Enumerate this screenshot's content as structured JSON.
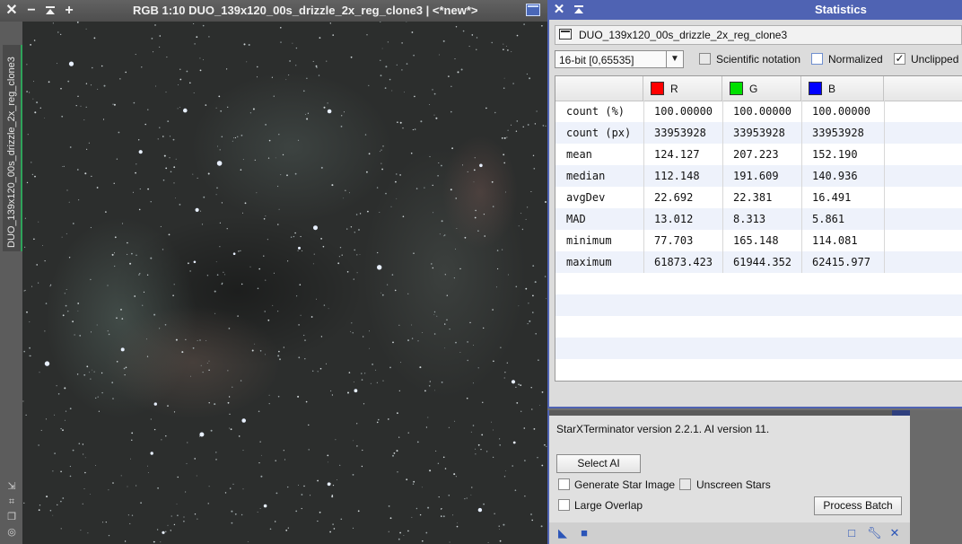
{
  "image_window": {
    "title": "RGB 1:10 DUO_139x120_00s_drizzle_2x_reg_clone3 | <*new*>",
    "side_tab_label": "DUO_139x120_00s_drizzle_2x_reg_clone3",
    "buttons": {
      "close": "✕",
      "minimize": "−",
      "shade": "⏶",
      "maximize_plus": "+"
    }
  },
  "statistics": {
    "window_title": "Statistics",
    "view_name": "DUO_139x120_00s_drizzle_2x_reg_clone3",
    "range": "16-bit [0,65535]",
    "options": [
      {
        "label": "Scientific notation",
        "checked": false
      },
      {
        "label": "Normalized",
        "checked": false
      },
      {
        "label": "Unclipped",
        "checked": true
      }
    ],
    "channels": [
      {
        "label": "R",
        "color": "#ff0000"
      },
      {
        "label": "G",
        "color": "#00e000"
      },
      {
        "label": "B",
        "color": "#0000ff"
      }
    ],
    "rows": [
      {
        "name": "count (%)",
        "r": "100.00000",
        "g": "100.00000",
        "b": "100.00000"
      },
      {
        "name": "count (px)",
        "r": "33953928",
        "g": "33953928",
        "b": "33953928"
      },
      {
        "name": "mean",
        "r": "124.127",
        "g": "207.223",
        "b": "152.190"
      },
      {
        "name": "median",
        "r": "112.148",
        "g": "191.609",
        "b": "140.936"
      },
      {
        "name": "avgDev",
        "r": "22.692",
        "g": "22.381",
        "b": "16.491"
      },
      {
        "name": "MAD",
        "r": "13.012",
        "g": "8.313",
        "b": "5.861"
      },
      {
        "name": "minimum",
        "r": "77.703",
        "g": "165.148",
        "b": "114.081"
      },
      {
        "name": "maximum",
        "r": "61873.423",
        "g": "61944.352",
        "b": "62415.977"
      }
    ]
  },
  "starx": {
    "version_text": "StarXTerminator version 2.2.1. AI version 11.",
    "select_ai": "Select AI",
    "generate_star_image": "Generate Star Image",
    "unscreen_stars": "Unscreen Stars",
    "large_overlap": "Large Overlap",
    "process_batch": "Process Batch"
  },
  "colors": {
    "accent": "#4f63b3",
    "active_tab": "#2fa35a"
  }
}
